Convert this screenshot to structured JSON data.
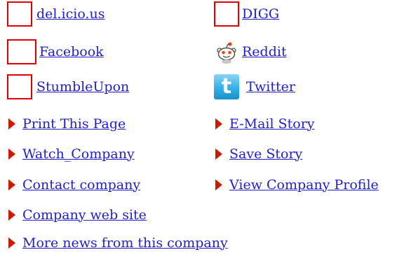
{
  "share": {
    "delicious": "del.icio.us",
    "digg": "DIGG",
    "facebook": "Facebook",
    "reddit": "Reddit",
    "stumbleupon": "StumbleUpon",
    "twitter": "Twitter"
  },
  "actions": {
    "print": "Print This Page",
    "email": "E-Mail Story",
    "watch": "Watch_Company",
    "save": "Save Story",
    "contact": "Contact company",
    "profile": "View Company Profile",
    "website": "Company web site",
    "more_news": "More news from this company"
  },
  "icons": {
    "broken_image": "broken-image-icon",
    "reddit": "reddit-alien-icon",
    "twitter": "twitter-icon",
    "bullet": "red-arrow-bullet-icon"
  },
  "colors": {
    "link": "#1f1fcc",
    "bullet": "#cc1a00",
    "placeholder_border": "#e00000"
  }
}
